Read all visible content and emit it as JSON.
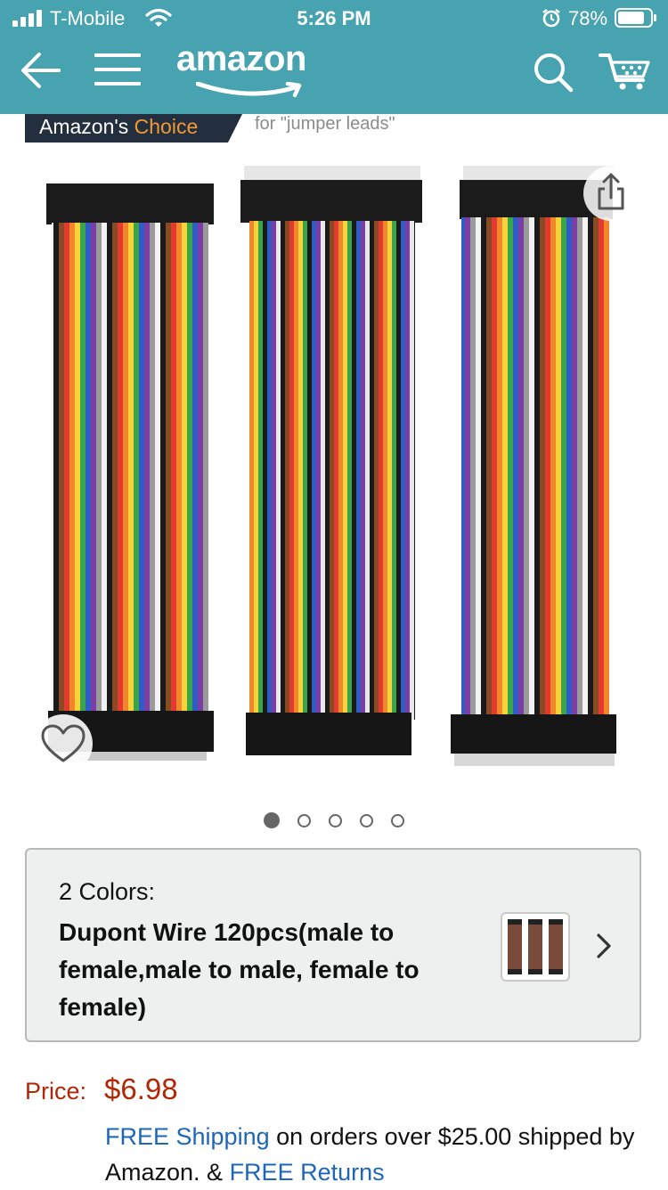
{
  "status_bar": {
    "carrier": "T-Mobile",
    "time": "5:26 PM",
    "battery": "78%"
  },
  "header": {
    "logo_text": "amazon",
    "brand_color": "#48a3b1",
    "icons": [
      "back-arrow-icon",
      "menu-icon",
      "search-icon",
      "cart-icon"
    ]
  },
  "choice": {
    "badge_left": "Amazon's ",
    "badge_right": "Choice",
    "for_text": "for \"jumper leads\""
  },
  "gallery": {
    "image_count": 5,
    "active_index": 0
  },
  "variant": {
    "label": "2 Colors:",
    "name": "Dupont Wire 120pcs(male to female,male to male, female to female)"
  },
  "price": {
    "label": "Price:",
    "value": "$6.98",
    "color": "#b12704"
  },
  "shipping": {
    "free_shipping": "FREE Shipping",
    "text1": " on orders over $25.00 shipped by Amazon. & ",
    "free_returns": "FREE Returns",
    "link_color": "#1e66b9"
  }
}
